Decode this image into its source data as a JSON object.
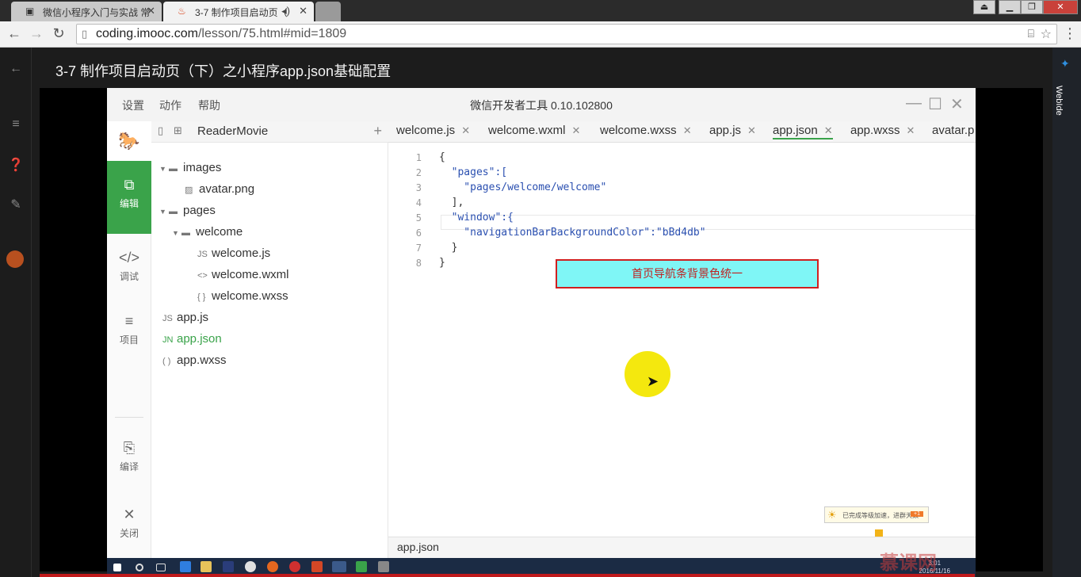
{
  "browser": {
    "tabs": [
      {
        "title": "微信小程序入门与实战 常",
        "active": false
      },
      {
        "title": "3-7 制作项目启动页（",
        "active": true
      }
    ],
    "url_host": "coding.imooc.com",
    "url_path": "/lesson/75.html#mid=1809"
  },
  "page": {
    "lesson_title": "3-7 制作项目启动页（下）之小程序app.json基础配置",
    "side_tab": "WebIde"
  },
  "devtool": {
    "menus": [
      "设置",
      "动作",
      "帮助"
    ],
    "title": "微信开发者工具 0.10.102800",
    "nav": [
      {
        "icon": "code-icon",
        "label": "编辑",
        "active": true
      },
      {
        "icon": "debug-icon",
        "label": "调试",
        "active": false
      },
      {
        "icon": "project-icon",
        "label": "项目",
        "active": false
      },
      {
        "icon": "compile-icon",
        "label": "编译",
        "active": false
      },
      {
        "icon": "close-icon",
        "label": "关闭",
        "active": false
      }
    ],
    "project_name": "ReaderMovie",
    "tree": [
      {
        "label": "images",
        "type": "folder",
        "depth": 0,
        "open": true
      },
      {
        "label": "avatar.png",
        "type": "image",
        "depth": 1
      },
      {
        "label": "pages",
        "type": "folder",
        "depth": 0,
        "open": true
      },
      {
        "label": "welcome",
        "type": "folder",
        "depth": 1,
        "open": true
      },
      {
        "label": "welcome.js",
        "type": "js",
        "depth": 2
      },
      {
        "label": "welcome.wxml",
        "type": "wxml",
        "depth": 2
      },
      {
        "label": "welcome.wxss",
        "type": "wxss",
        "depth": 2
      },
      {
        "label": "app.js",
        "type": "js",
        "depth": 0
      },
      {
        "label": "app.json",
        "type": "json",
        "depth": 0,
        "selected": true
      },
      {
        "label": "app.wxss",
        "type": "wxss",
        "depth": 0
      }
    ],
    "editor_tabs": [
      "welcome.js",
      "welcome.wxml",
      "welcome.wxss",
      "app.js",
      "app.json",
      "app.wxss",
      "avatar.p"
    ],
    "active_tab": "app.json",
    "code_lines": [
      "{",
      "  \"pages\":[",
      "    \"pages/welcome/welcome\"",
      "  ],",
      "  \"window\":{",
      "    \"navigationBarBackgroundColor\":\"bBd4db\"",
      "  }",
      "}"
    ],
    "line_numbers": [
      "1",
      "2",
      "3",
      "4",
      "5",
      "6",
      "7",
      "8"
    ],
    "annotation": "首页导航条背景色统一",
    "status_file": "app.json",
    "toast_text": "已完成等级加速，进群天数",
    "toast_badge": "+1"
  },
  "taskbar": {
    "time": "3:01",
    "date": "2016/11/16",
    "watermark": "慕课网"
  },
  "colors": {
    "accent_green": "#3aa34a",
    "annotation_bg": "#7ff6f6",
    "annotation_border": "#d01f1f"
  }
}
